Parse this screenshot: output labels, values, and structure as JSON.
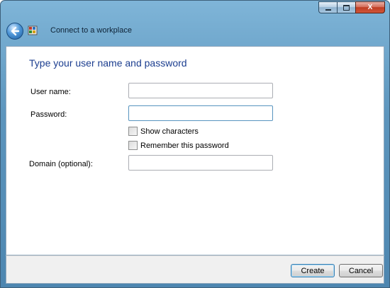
{
  "window": {
    "title": "Connect to a workplace",
    "icons": {
      "back": "back-arrow-icon",
      "app": "network-workplace-icon",
      "minimize": "minimize-icon",
      "maximize": "maximize-icon",
      "close": "close-icon"
    },
    "close_glyph": "X"
  },
  "form": {
    "heading": "Type your user name and password",
    "username_label": "User name:",
    "username_value": "",
    "password_label": "Password:",
    "password_value": "",
    "show_characters_label": "Show characters",
    "show_characters_checked": false,
    "remember_password_label": "Remember this password",
    "remember_password_checked": false,
    "domain_label": "Domain (optional):",
    "domain_value": ""
  },
  "footer": {
    "create_label": "Create",
    "cancel_label": "Cancel"
  },
  "colors": {
    "heading": "#1b3d8f",
    "titlebar": "#5c95bd",
    "close_button": "#bf3d23"
  }
}
